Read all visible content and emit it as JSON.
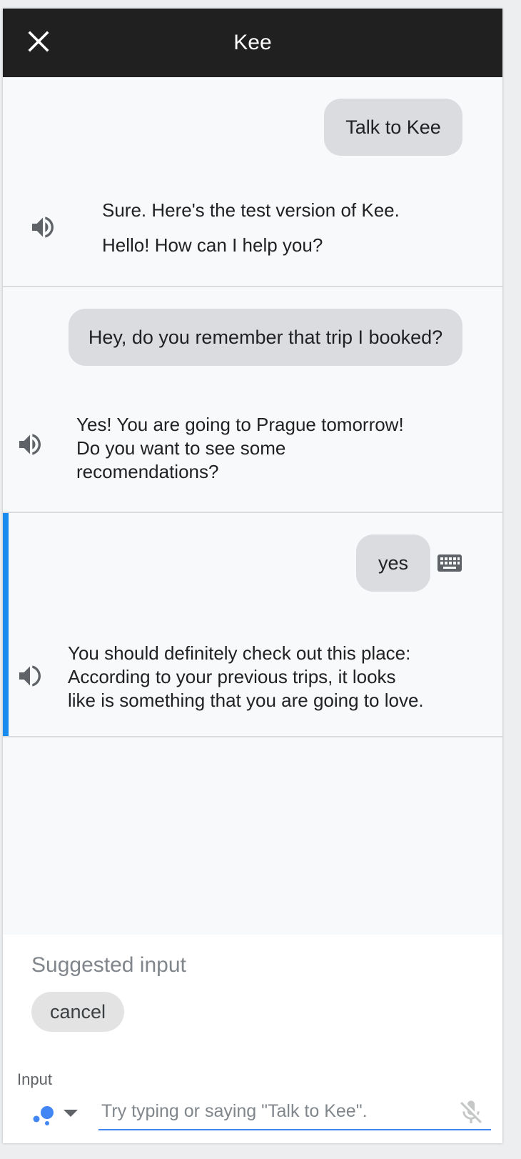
{
  "header": {
    "title": "Kee",
    "close_icon": "close-icon"
  },
  "conversation": [
    {
      "user": "Talk to Kee",
      "agent_lines": [
        "Sure. Here's the test version of Kee.",
        "Hello! How can I help you?"
      ]
    },
    {
      "user": "Hey, do you remember that trip I booked?",
      "agent_lines": [
        "Yes! You are going to Prague tomorrow!",
        "Do you want to see some",
        "recomendations?"
      ]
    },
    {
      "user": "yes",
      "agent_lines": [
        "You should definitely check out this place:",
        "According to your previous trips, it looks",
        "like is something that you are going to love."
      ]
    }
  ],
  "suggestions": {
    "title": "Suggested input",
    "chips": [
      "cancel"
    ]
  },
  "input": {
    "label": "Input",
    "placeholder": "Try typing or saying \"Talk to Kee\".",
    "value": ""
  },
  "colors": {
    "header_bg": "#202020",
    "panel_bg": "#f8f9fa",
    "bubble_bg": "#dadce0",
    "active_accent": "#1a8cf0",
    "input_underline": "#4285f4"
  },
  "icons": [
    "close-icon",
    "speaker-icon",
    "keyboard-icon",
    "assistant-icon",
    "chevron-down-icon",
    "mic-off-icon"
  ]
}
